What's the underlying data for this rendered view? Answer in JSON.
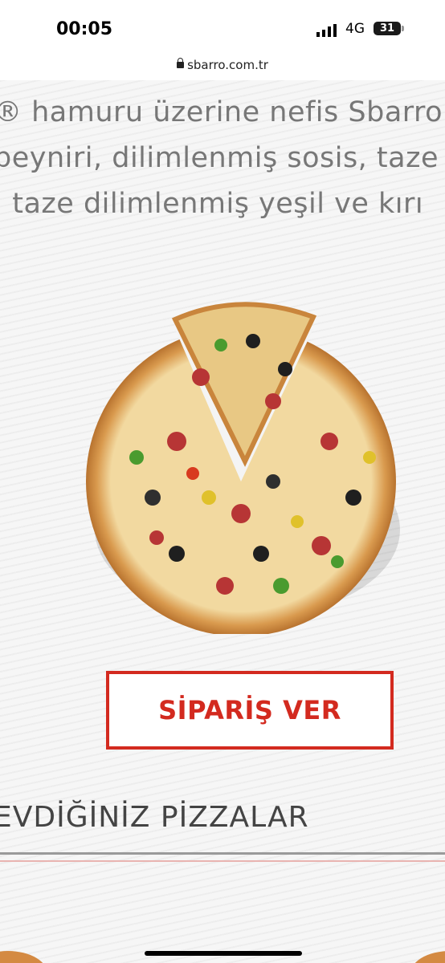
{
  "status_bar": {
    "time": "00:05",
    "network": "4G",
    "battery": "31",
    "signal_icon": "cellular-signal-icon",
    "battery_icon": "battery-icon"
  },
  "browser": {
    "url": "sbarro.com.tr",
    "lock_icon": "lock-icon"
  },
  "description_lines": [
    "® hamuru üzerine nefis Sbarro",
    "peyniri, dilimlenmiş sosis, taze",
    ", taze dilimlenmiş yeşil ve kırı"
  ],
  "product_image": "pizza-image",
  "order_button_label": "SİPARİŞ VER",
  "section_heading": "EVDİĞİNİZ PİZZALAR",
  "colors": {
    "accent": "#d32a1f",
    "text": "#777777",
    "heading": "#444444"
  }
}
